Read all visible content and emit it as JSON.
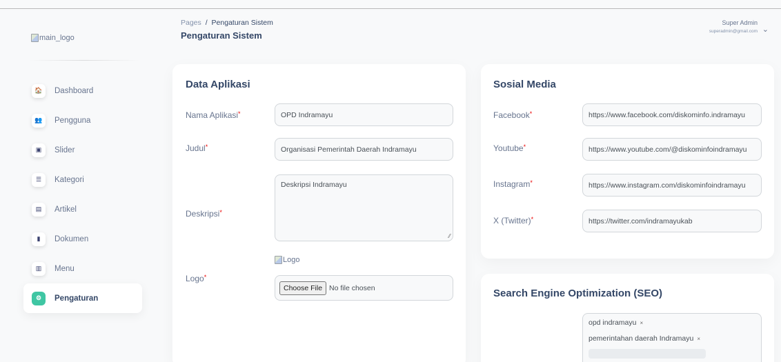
{
  "sidebar": {
    "logo_alt": "main_logo",
    "items": [
      {
        "label": "Dashboard",
        "icon": "home-icon",
        "glyph": "🏠",
        "active": false
      },
      {
        "label": "Pengguna",
        "icon": "users-icon",
        "glyph": "👥",
        "active": false
      },
      {
        "label": "Slider",
        "icon": "image-icon",
        "glyph": "▣",
        "active": false
      },
      {
        "label": "Kategori",
        "icon": "list-icon",
        "glyph": "☰",
        "active": false
      },
      {
        "label": "Artikel",
        "icon": "article-icon",
        "glyph": "▤",
        "active": false
      },
      {
        "label": "Dokumen",
        "icon": "document-icon",
        "glyph": "▮",
        "active": false
      },
      {
        "label": "Menu",
        "icon": "menu-icon",
        "glyph": "▥",
        "active": false
      },
      {
        "label": "Pengaturan",
        "icon": "gears-icon",
        "glyph": "⚙",
        "active": true
      }
    ]
  },
  "header": {
    "breadcrumb_root": "Pages",
    "breadcrumb_sep": "/",
    "breadcrumb_current": "Pengaturan Sistem",
    "title": "Pengaturan Sistem",
    "user_name": "Super Admin",
    "user_email": "superadmin@gmail.com"
  },
  "data_aplikasi": {
    "title": "Data Aplikasi",
    "nama_label": "Nama Aplikasi",
    "nama_value": "OPD Indramayu",
    "judul_label": "Judul",
    "judul_value": "Organisasi Pemerintah Daerah Indramayu",
    "deskripsi_label": "Deskripsi",
    "deskripsi_value": "Deskripsi Indramayu",
    "logo_label": "Logo",
    "logo_alt": "Logo",
    "file_button": "Choose File",
    "file_status": "No file chosen",
    "required_mark": "*"
  },
  "sosial_media": {
    "title": "Sosial Media",
    "facebook_label": "Facebook",
    "facebook_value": "https://www.facebook.com/diskominfo.indramayu",
    "youtube_label": "Youtube",
    "youtube_value": "https://www.youtube.com/@diskominfoindramayu",
    "instagram_label": "Instagram",
    "instagram_value": "https://www.instagram.com/diskominfoindramayu",
    "twitter_label": "X (Twitter)",
    "twitter_value": "https://twitter.com/indramayukab"
  },
  "seo": {
    "title": "Search Engine Optimization (SEO)",
    "tags": [
      "opd indramayu",
      "pemerintahan daerah Indramayu"
    ],
    "remove_glyph": "×"
  }
}
